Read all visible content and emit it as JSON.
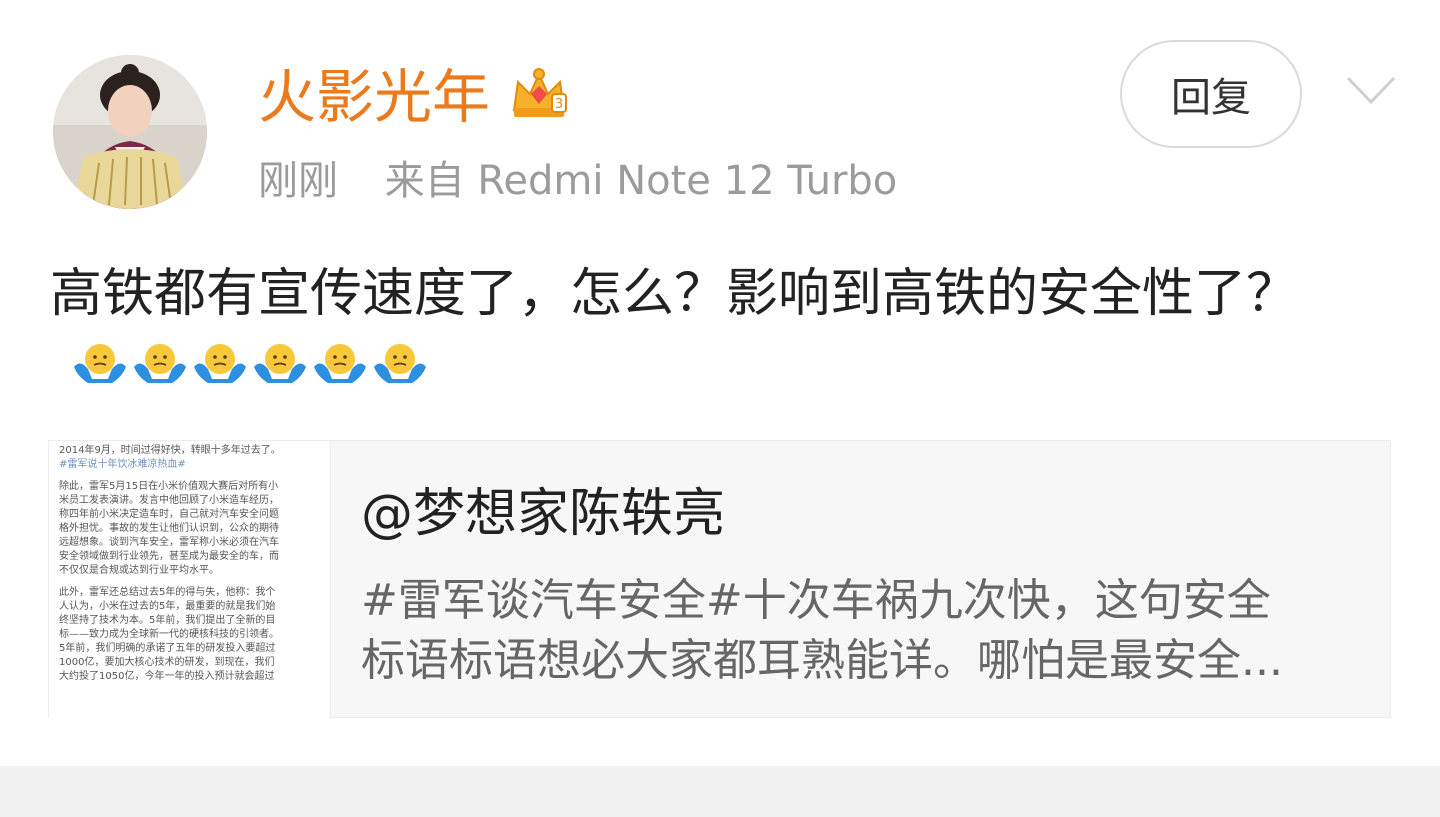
{
  "post": {
    "author": {
      "name": "火影光年",
      "badge": "crown-icon"
    },
    "meta": {
      "time": "刚刚",
      "source": "来自 Redmi Note 12 Turbo"
    },
    "actions": {
      "reply_label": "回复",
      "more_icon": "chevron-down-icon"
    },
    "text": "高铁都有宣传速度了，怎么？影响到高铁的安全性了？",
    "emoji": [
      "shrug-icon",
      "shrug-icon",
      "shrug-icon",
      "shrug-icon",
      "shrug-icon",
      "shrug-icon"
    ]
  },
  "repost": {
    "author": "@梦想家陈轶亮",
    "excerpt_line1": "#雷军谈汽车安全#十次车祸九次快，这句安全",
    "excerpt_line2": "标语标语想必大家都耳熟能详。哪怕是最安全...",
    "thumbnail": {
      "lines": [
        "2014年9月，时间过得好快，转眼十多年过去了。",
        "#雷军说十年饮冰难凉热血#",
        "",
        "除此，雷军5月15日在小米价值观大赛后对所有小",
        "米员工发表演讲。发言中他回顾了小米造车经历，",
        "称四年前小米决定造车时，自己就对汽车安全问题",
        "格外担忧。事故的发生让他们认识到，公众的期待",
        "远超想象。谈到汽车安全，雷军称小米必须在汽车",
        "安全领域做到行业领先，甚至成为最安全的车，而",
        "不仅仅是合规或达到行业平均水平。",
        "",
        "此外，雷军还总结过去5年的得与失，他称：我个",
        "人认为，小米在过去的5年，最重要的就是我们始",
        "终坚持了技术为本。5年前，我们提出了全新的目",
        "标——致力成为全球新一代的硬核科技的引领者。",
        "5年前，我们明确的承诺了五年的研发投入要超过",
        "1000亿，要加大核心技术的研发，到现在，我们",
        "大约投了1050亿，今年一年的投入预计就会超过"
      ]
    }
  },
  "colors": {
    "username": "#eb7a1d",
    "meta": "#9b9b9b",
    "text": "#222222",
    "excerpt": "#666666",
    "card_bg": "#f7f7f7",
    "footer_bg": "#f1f1f1"
  }
}
